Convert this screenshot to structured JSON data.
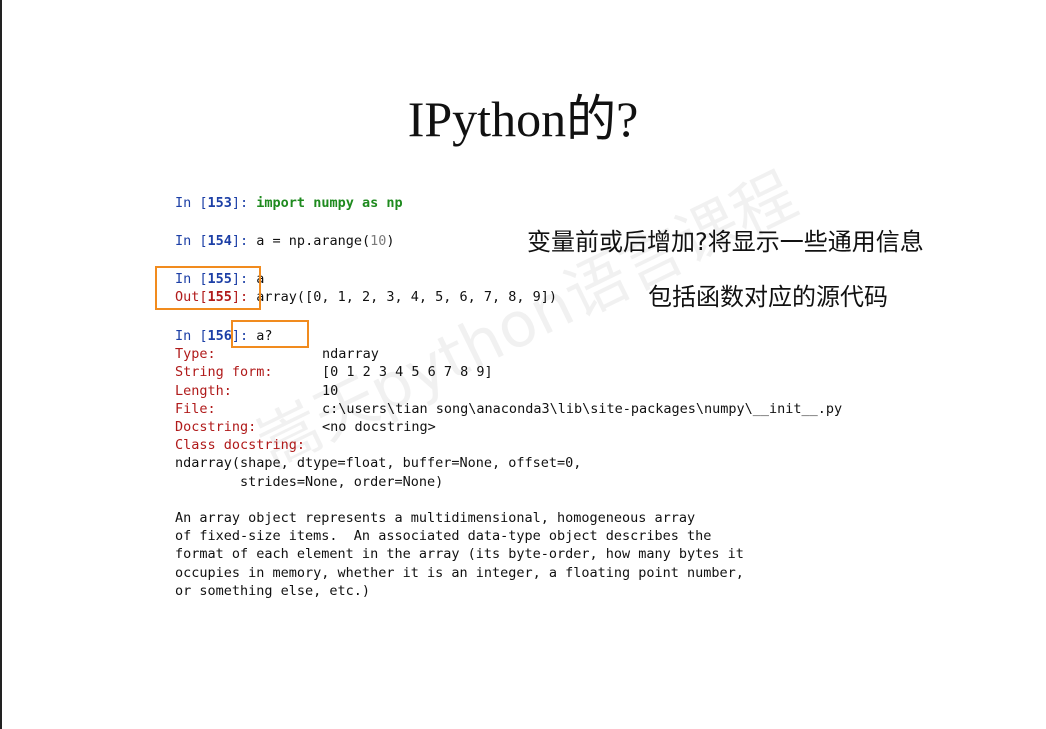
{
  "slide": {
    "title": "IPython的?",
    "note_line1": "变量前或后增加?将显示一些通用信息",
    "note_line2": "包括函数对应的源代码"
  },
  "cells": {
    "c153": {
      "prompt": "In [",
      "num": "153",
      "close": "]: ",
      "code_kw1": "import",
      "code_mod": " numpy ",
      "code_kw2": "as",
      "code_alias": " np"
    },
    "c154": {
      "prompt": "In [",
      "num": "154",
      "close": "]: ",
      "code_a": "a = np.arange(",
      "code_lit": "10",
      "code_b": ")"
    },
    "c155": {
      "prompt": "In [",
      "num": "155",
      "close": "]: ",
      "code": "a",
      "out_prompt": "Out[",
      "out_num": "155",
      "out_close": "]: ",
      "output": "array([0, 1, 2, 3, 4, 5, 6, 7, 8, 9])"
    },
    "c156": {
      "prompt": "In [",
      "num": "156",
      "close": "]: ",
      "code": "a?"
    }
  },
  "help": {
    "type_label": "Type:",
    "type_value": "ndarray",
    "string_form_label": "String form:",
    "string_form_value": "[0 1 2 3 4 5 6 7 8 9]",
    "length_label": "Length:",
    "length_value": "10",
    "file_label": "File:",
    "file_value": "c:\\users\\tian song\\anaconda3\\lib\\site-packages\\numpy\\__init__.py",
    "docstring_label": "Docstring:",
    "docstring_value": "<no docstring>",
    "class_docstring_label": "Class docstring:",
    "signature_1": "ndarray(shape, dtype=float, buffer=None, offset=0,",
    "signature_2": "        strides=None, order=None)",
    "desc_1": "An array object represents a multidimensional, homogeneous array",
    "desc_2": "of fixed-size items.  An associated data-type object describes the",
    "desc_3": "format of each element in the array (its byte-order, how many bytes it",
    "desc_4": "occupies in memory, whether it is an integer, a floating point number,",
    "desc_5": "or something else, etc.)"
  },
  "colors": {
    "highlight_box": "#f18b1e",
    "in_prompt": "#1c3fa6",
    "out_prompt": "#b01a1a",
    "keyword": "#1e8a1e"
  },
  "watermark": "嵩天python语言课程"
}
